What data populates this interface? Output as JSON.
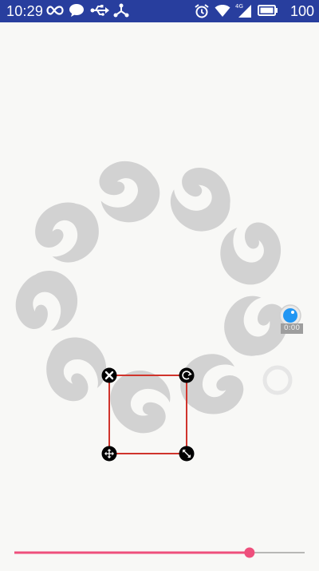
{
  "status_bar": {
    "time": "10:29",
    "battery_percent": "100",
    "network_type": "4G",
    "background_color": "#283e9e"
  },
  "editor": {
    "selection_color": "#d0342c",
    "handle_color": "#000000",
    "handles": [
      "close-icon",
      "rotate-icon",
      "move-icon",
      "resize-icon"
    ],
    "timer": "0:00",
    "accent_color": "#2196f3"
  },
  "seekbar": {
    "progress": 0.81,
    "color": "#ee4f7c",
    "track_color": "#777777"
  }
}
